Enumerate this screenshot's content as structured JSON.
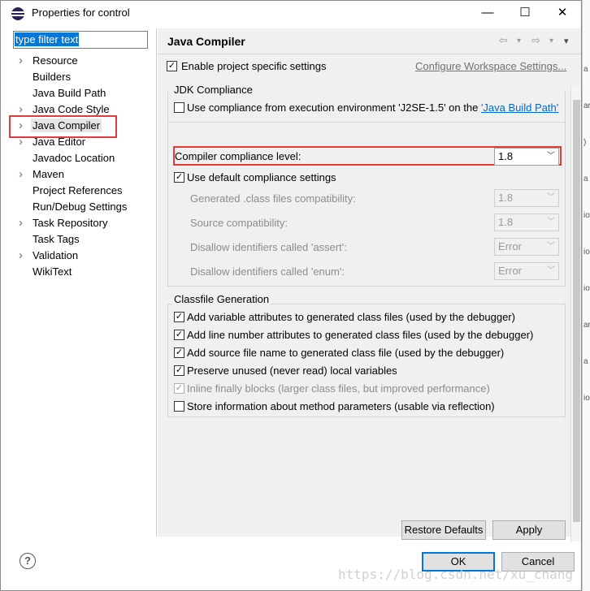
{
  "window": {
    "title": "Properties for control",
    "min_glyph": "—",
    "max_glyph": "☐",
    "close_glyph": "✕"
  },
  "filter": {
    "value": "type filter text"
  },
  "tree": {
    "items": [
      {
        "label": "Resource",
        "expandable": true
      },
      {
        "label": "Builders",
        "expandable": false
      },
      {
        "label": "Java Build Path",
        "expandable": false
      },
      {
        "label": "Java Code Style",
        "expandable": true
      },
      {
        "label": "Java Compiler",
        "expandable": true,
        "selected": true
      },
      {
        "label": "Java Editor",
        "expandable": true
      },
      {
        "label": "Javadoc Location",
        "expandable": false
      },
      {
        "label": "Maven",
        "expandable": true
      },
      {
        "label": "Project References",
        "expandable": false
      },
      {
        "label": "Run/Debug Settings",
        "expandable": false
      },
      {
        "label": "Task Repository",
        "expandable": true
      },
      {
        "label": "Task Tags",
        "expandable": false
      },
      {
        "label": "Validation",
        "expandable": true
      },
      {
        "label": "WikiText",
        "expandable": false
      }
    ]
  },
  "header": {
    "title": "Java Compiler",
    "back_glyph": "⇦",
    "forward_glyph": "⇨",
    "dropdown_glyph": "▾",
    "menu_glyph": "▾"
  },
  "project": {
    "enable_label": "Enable project specific settings",
    "enable_checked": true,
    "configure_link": "Configure Workspace Settings..."
  },
  "jdk": {
    "legend": "JDK Compliance",
    "use_env_label": "Use compliance from execution environment 'J2SE-1.5' on the ",
    "use_env_link": "'Java Build Path'",
    "use_env_checked": false,
    "compliance_label": "Compiler compliance level:",
    "compliance_value": "1.8",
    "default_label": "Use default compliance settings",
    "default_checked": true,
    "rows": [
      {
        "label": "Generated .class files compatibility:",
        "value": "1.8"
      },
      {
        "label": "Source compatibility:",
        "value": "1.8"
      },
      {
        "label": "Disallow identifiers called 'assert':",
        "value": "Error"
      },
      {
        "label": "Disallow identifiers called 'enum':",
        "value": "Error"
      }
    ]
  },
  "classfile": {
    "legend": "Classfile Generation",
    "items": [
      {
        "label": "Add variable attributes to generated class files (used by the debugger)",
        "checked": true,
        "disabled": false
      },
      {
        "label": "Add line number attributes to generated class files (used by the debugger)",
        "checked": true,
        "disabled": false
      },
      {
        "label": "Add source file name to generated class file (used by the debugger)",
        "checked": true,
        "disabled": false
      },
      {
        "label": "Preserve unused (never read) local variables",
        "checked": true,
        "disabled": false
      },
      {
        "label": "Inline finally blocks (larger class files, but improved performance)",
        "checked": true,
        "disabled": true
      },
      {
        "label": "Store information about method parameters (usable via reflection)",
        "checked": false,
        "disabled": false
      }
    ]
  },
  "buttons": {
    "restore": "Restore Defaults",
    "apply": "Apply",
    "ok": "OK",
    "cancel": "Cancel",
    "help": "?"
  },
  "watermark": "https://blog.csdn.net/xu_chang",
  "background_fragments": [
    "a",
    "ar",
    ")",
    "a",
    "io",
    "io",
    "io",
    "ar",
    "a",
    "io"
  ],
  "colors": {
    "accent": "#0078d7",
    "highlight": "#e33b3b",
    "link": "#0066cc"
  }
}
